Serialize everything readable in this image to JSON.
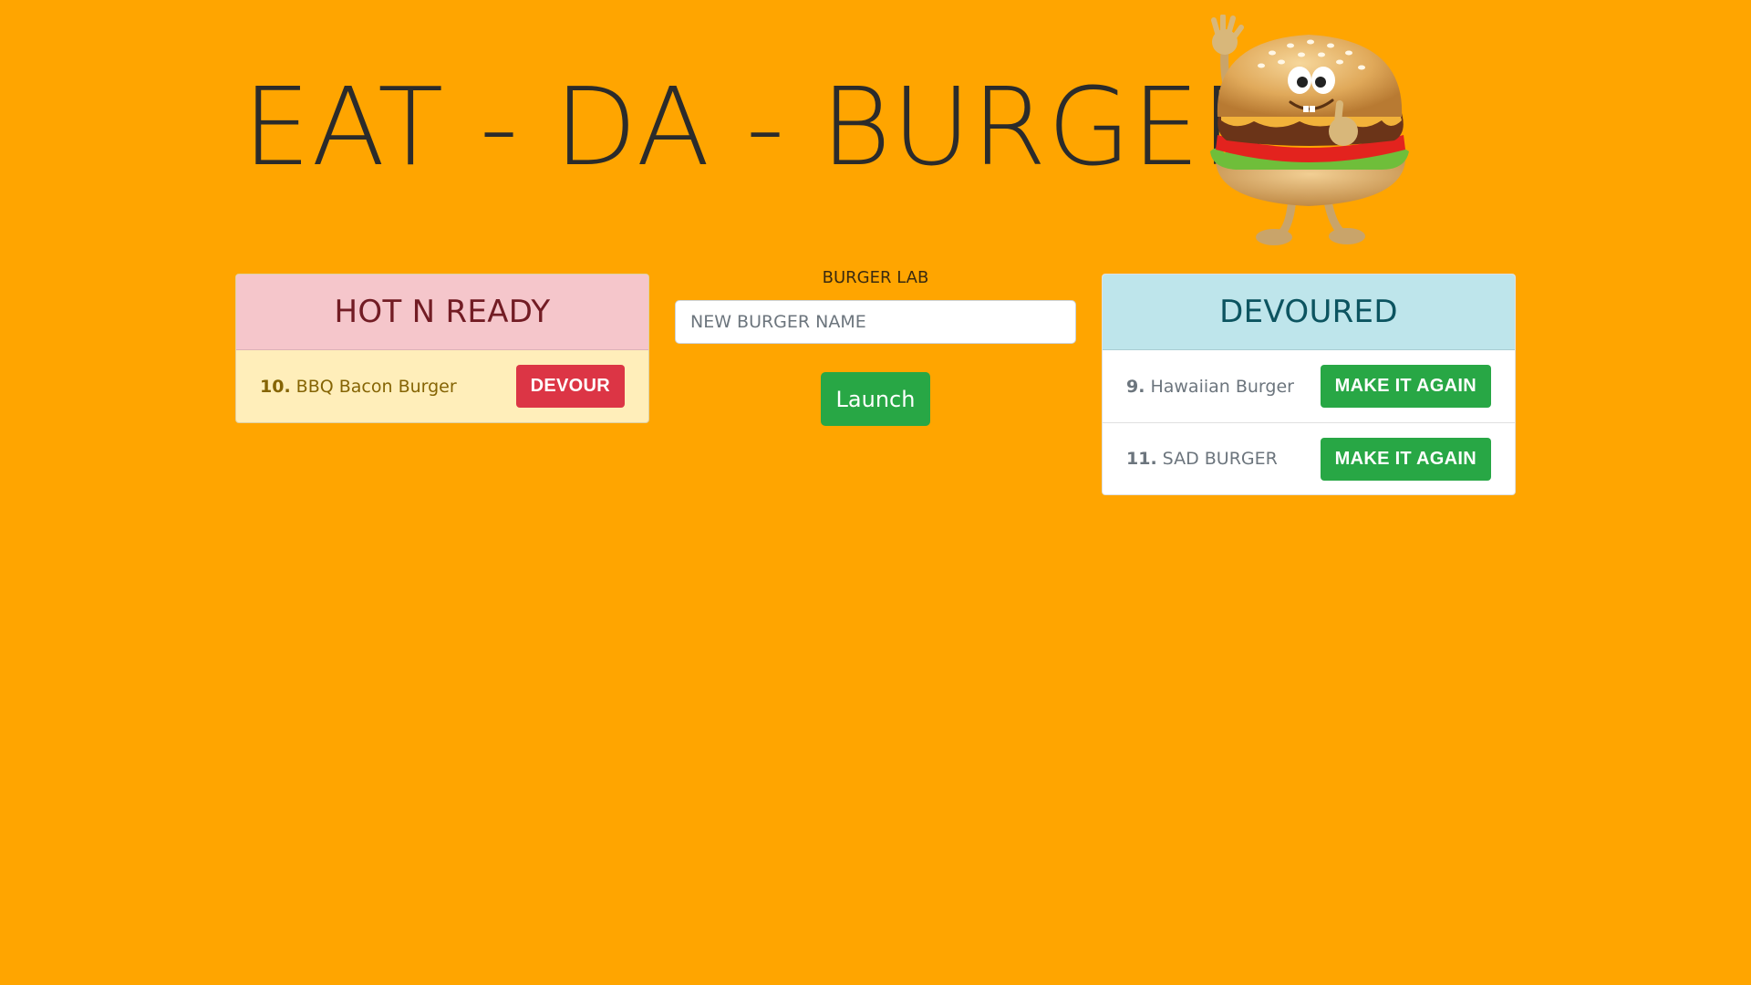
{
  "header": {
    "title": "EAT - DA - BURGER",
    "mascot_icon": "waving-burger-mascot"
  },
  "hot_n_ready": {
    "title": "HOT N READY",
    "items": [
      {
        "number": "10.",
        "name": "BBQ Bacon Burger",
        "button_label": "DEVOUR"
      }
    ]
  },
  "burger_lab": {
    "label": "BURGER LAB",
    "input_value": "",
    "input_placeholder": "NEW BURGER NAME",
    "launch_label": "Launch"
  },
  "devoured": {
    "title": "DEVOURED",
    "items": [
      {
        "number": "9.",
        "name": "Hawaiian Burger",
        "button_label": "MAKE IT AGAIN"
      },
      {
        "number": "11.",
        "name": "SAD BURGER",
        "button_label": "MAKE IT AGAIN"
      }
    ]
  },
  "colors": {
    "background": "#FFA500",
    "hot_header_bg": "#F5C6CB",
    "hot_body_bg": "#FFEEBA",
    "devoured_header_bg": "#BEE5EB",
    "danger": "#DC3545",
    "success": "#28A745"
  }
}
